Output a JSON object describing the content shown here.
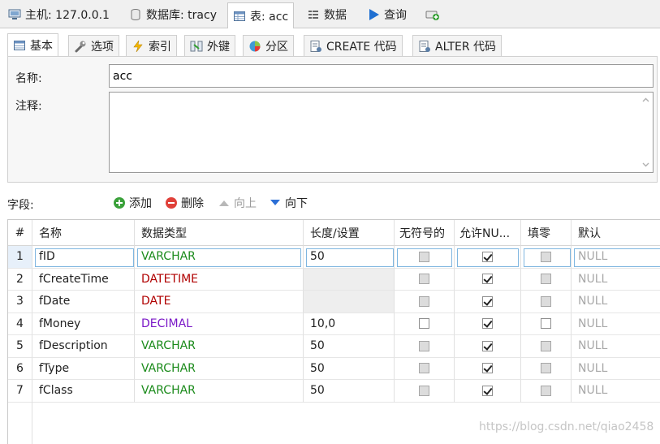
{
  "top_tabs": [
    {
      "label": "主机: 127.0.0.1",
      "icon": "host-icon"
    },
    {
      "label": "数据库: tracy",
      "icon": "database-icon"
    },
    {
      "label": "表: acc",
      "icon": "table-icon"
    },
    {
      "label": "数据",
      "icon": "data-icon"
    },
    {
      "label": "查询",
      "icon": "play-icon"
    },
    {
      "label": "",
      "icon": "new-query-icon"
    }
  ],
  "sub_tabs": [
    {
      "label": "基本",
      "icon": "table-icon"
    },
    {
      "label": "选项",
      "icon": "wrench-icon"
    },
    {
      "label": "索引",
      "icon": "lightning-icon"
    },
    {
      "label": "外键",
      "icon": "foreign-key-icon"
    },
    {
      "label": "分区",
      "icon": "pie-icon"
    },
    {
      "label": "CREATE 代码",
      "icon": "code-icon"
    },
    {
      "label": "ALTER 代码",
      "icon": "code-icon"
    }
  ],
  "basic": {
    "name_label": "名称:",
    "name_value": "acc",
    "comment_label": "注释:",
    "comment_value": ""
  },
  "fields_toolbar": {
    "label": "字段:",
    "add": "添加",
    "delete": "删除",
    "up": "向上",
    "down": "向下"
  },
  "columns": {
    "num": "#",
    "name": "名称",
    "type": "数据类型",
    "length": "长度/设置",
    "unsigned": "无符号的",
    "nullable": "允许NU...",
    "zerofill": "填零",
    "default": "默认"
  },
  "rows": [
    {
      "num": "1",
      "name": "fID",
      "type": "VARCHAR",
      "type_color": "#1a8a1a",
      "length": "50",
      "unsigned": false,
      "unsigned_disabled": true,
      "nullable": true,
      "zerofill": false,
      "zerofill_disabled": true,
      "default": "NULL"
    },
    {
      "num": "2",
      "name": "fCreateTime",
      "type": "DATETIME",
      "type_color": "#b00000",
      "length": "",
      "unsigned": false,
      "unsigned_disabled": true,
      "nullable": true,
      "zerofill": false,
      "zerofill_disabled": true,
      "default": "NULL"
    },
    {
      "num": "3",
      "name": "fDate",
      "type": "DATE",
      "type_color": "#b00000",
      "length": "",
      "unsigned": false,
      "unsigned_disabled": true,
      "nullable": true,
      "zerofill": false,
      "zerofill_disabled": true,
      "default": "NULL"
    },
    {
      "num": "4",
      "name": "fMoney",
      "type": "DECIMAL",
      "type_color": "#7a17c7",
      "length": "10,0",
      "unsigned": false,
      "unsigned_disabled": false,
      "nullable": true,
      "zerofill": false,
      "zerofill_disabled": false,
      "default": "NULL"
    },
    {
      "num": "5",
      "name": "fDescription",
      "type": "VARCHAR",
      "type_color": "#1a8a1a",
      "length": "50",
      "unsigned": false,
      "unsigned_disabled": true,
      "nullable": true,
      "zerofill": false,
      "zerofill_disabled": true,
      "default": "NULL"
    },
    {
      "num": "6",
      "name": "fType",
      "type": "VARCHAR",
      "type_color": "#1a8a1a",
      "length": "50",
      "unsigned": false,
      "unsigned_disabled": true,
      "nullable": true,
      "zerofill": false,
      "zerofill_disabled": true,
      "default": "NULL"
    },
    {
      "num": "7",
      "name": "fClass",
      "type": "VARCHAR",
      "type_color": "#1a8a1a",
      "length": "50",
      "unsigned": false,
      "unsigned_disabled": true,
      "nullable": true,
      "zerofill": false,
      "zerofill_disabled": true,
      "default": "NULL"
    }
  ],
  "watermark": "https://blog.csdn.net/qiao2458"
}
